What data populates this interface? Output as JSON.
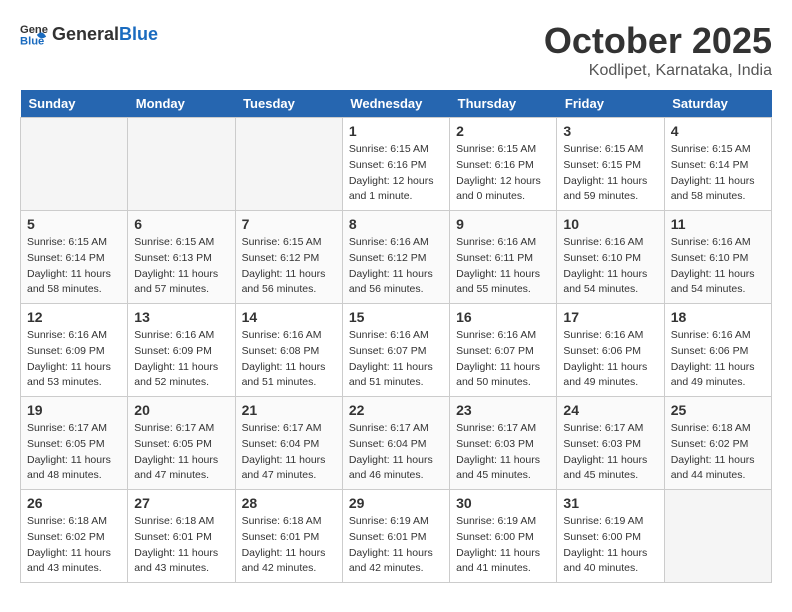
{
  "header": {
    "logo_general": "General",
    "logo_blue": "Blue",
    "month": "October 2025",
    "location": "Kodlipet, Karnataka, India"
  },
  "weekdays": [
    "Sunday",
    "Monday",
    "Tuesday",
    "Wednesday",
    "Thursday",
    "Friday",
    "Saturday"
  ],
  "weeks": [
    [
      {
        "day": "",
        "sunrise": "",
        "sunset": "",
        "daylight": ""
      },
      {
        "day": "",
        "sunrise": "",
        "sunset": "",
        "daylight": ""
      },
      {
        "day": "",
        "sunrise": "",
        "sunset": "",
        "daylight": ""
      },
      {
        "day": "1",
        "sunrise": "Sunrise: 6:15 AM",
        "sunset": "Sunset: 6:16 PM",
        "daylight": "Daylight: 12 hours and 1 minute."
      },
      {
        "day": "2",
        "sunrise": "Sunrise: 6:15 AM",
        "sunset": "Sunset: 6:16 PM",
        "daylight": "Daylight: 12 hours and 0 minutes."
      },
      {
        "day": "3",
        "sunrise": "Sunrise: 6:15 AM",
        "sunset": "Sunset: 6:15 PM",
        "daylight": "Daylight: 11 hours and 59 minutes."
      },
      {
        "day": "4",
        "sunrise": "Sunrise: 6:15 AM",
        "sunset": "Sunset: 6:14 PM",
        "daylight": "Daylight: 11 hours and 58 minutes."
      }
    ],
    [
      {
        "day": "5",
        "sunrise": "Sunrise: 6:15 AM",
        "sunset": "Sunset: 6:14 PM",
        "daylight": "Daylight: 11 hours and 58 minutes."
      },
      {
        "day": "6",
        "sunrise": "Sunrise: 6:15 AM",
        "sunset": "Sunset: 6:13 PM",
        "daylight": "Daylight: 11 hours and 57 minutes."
      },
      {
        "day": "7",
        "sunrise": "Sunrise: 6:15 AM",
        "sunset": "Sunset: 6:12 PM",
        "daylight": "Daylight: 11 hours and 56 minutes."
      },
      {
        "day": "8",
        "sunrise": "Sunrise: 6:16 AM",
        "sunset": "Sunset: 6:12 PM",
        "daylight": "Daylight: 11 hours and 56 minutes."
      },
      {
        "day": "9",
        "sunrise": "Sunrise: 6:16 AM",
        "sunset": "Sunset: 6:11 PM",
        "daylight": "Daylight: 11 hours and 55 minutes."
      },
      {
        "day": "10",
        "sunrise": "Sunrise: 6:16 AM",
        "sunset": "Sunset: 6:10 PM",
        "daylight": "Daylight: 11 hours and 54 minutes."
      },
      {
        "day": "11",
        "sunrise": "Sunrise: 6:16 AM",
        "sunset": "Sunset: 6:10 PM",
        "daylight": "Daylight: 11 hours and 54 minutes."
      }
    ],
    [
      {
        "day": "12",
        "sunrise": "Sunrise: 6:16 AM",
        "sunset": "Sunset: 6:09 PM",
        "daylight": "Daylight: 11 hours and 53 minutes."
      },
      {
        "day": "13",
        "sunrise": "Sunrise: 6:16 AM",
        "sunset": "Sunset: 6:09 PM",
        "daylight": "Daylight: 11 hours and 52 minutes."
      },
      {
        "day": "14",
        "sunrise": "Sunrise: 6:16 AM",
        "sunset": "Sunset: 6:08 PM",
        "daylight": "Daylight: 11 hours and 51 minutes."
      },
      {
        "day": "15",
        "sunrise": "Sunrise: 6:16 AM",
        "sunset": "Sunset: 6:07 PM",
        "daylight": "Daylight: 11 hours and 51 minutes."
      },
      {
        "day": "16",
        "sunrise": "Sunrise: 6:16 AM",
        "sunset": "Sunset: 6:07 PM",
        "daylight": "Daylight: 11 hours and 50 minutes."
      },
      {
        "day": "17",
        "sunrise": "Sunrise: 6:16 AM",
        "sunset": "Sunset: 6:06 PM",
        "daylight": "Daylight: 11 hours and 49 minutes."
      },
      {
        "day": "18",
        "sunrise": "Sunrise: 6:16 AM",
        "sunset": "Sunset: 6:06 PM",
        "daylight": "Daylight: 11 hours and 49 minutes."
      }
    ],
    [
      {
        "day": "19",
        "sunrise": "Sunrise: 6:17 AM",
        "sunset": "Sunset: 6:05 PM",
        "daylight": "Daylight: 11 hours and 48 minutes."
      },
      {
        "day": "20",
        "sunrise": "Sunrise: 6:17 AM",
        "sunset": "Sunset: 6:05 PM",
        "daylight": "Daylight: 11 hours and 47 minutes."
      },
      {
        "day": "21",
        "sunrise": "Sunrise: 6:17 AM",
        "sunset": "Sunset: 6:04 PM",
        "daylight": "Daylight: 11 hours and 47 minutes."
      },
      {
        "day": "22",
        "sunrise": "Sunrise: 6:17 AM",
        "sunset": "Sunset: 6:04 PM",
        "daylight": "Daylight: 11 hours and 46 minutes."
      },
      {
        "day": "23",
        "sunrise": "Sunrise: 6:17 AM",
        "sunset": "Sunset: 6:03 PM",
        "daylight": "Daylight: 11 hours and 45 minutes."
      },
      {
        "day": "24",
        "sunrise": "Sunrise: 6:17 AM",
        "sunset": "Sunset: 6:03 PM",
        "daylight": "Daylight: 11 hours and 45 minutes."
      },
      {
        "day": "25",
        "sunrise": "Sunrise: 6:18 AM",
        "sunset": "Sunset: 6:02 PM",
        "daylight": "Daylight: 11 hours and 44 minutes."
      }
    ],
    [
      {
        "day": "26",
        "sunrise": "Sunrise: 6:18 AM",
        "sunset": "Sunset: 6:02 PM",
        "daylight": "Daylight: 11 hours and 43 minutes."
      },
      {
        "day": "27",
        "sunrise": "Sunrise: 6:18 AM",
        "sunset": "Sunset: 6:01 PM",
        "daylight": "Daylight: 11 hours and 43 minutes."
      },
      {
        "day": "28",
        "sunrise": "Sunrise: 6:18 AM",
        "sunset": "Sunset: 6:01 PM",
        "daylight": "Daylight: 11 hours and 42 minutes."
      },
      {
        "day": "29",
        "sunrise": "Sunrise: 6:19 AM",
        "sunset": "Sunset: 6:01 PM",
        "daylight": "Daylight: 11 hours and 42 minutes."
      },
      {
        "day": "30",
        "sunrise": "Sunrise: 6:19 AM",
        "sunset": "Sunset: 6:00 PM",
        "daylight": "Daylight: 11 hours and 41 minutes."
      },
      {
        "day": "31",
        "sunrise": "Sunrise: 6:19 AM",
        "sunset": "Sunset: 6:00 PM",
        "daylight": "Daylight: 11 hours and 40 minutes."
      },
      {
        "day": "",
        "sunrise": "",
        "sunset": "",
        "daylight": ""
      }
    ]
  ]
}
